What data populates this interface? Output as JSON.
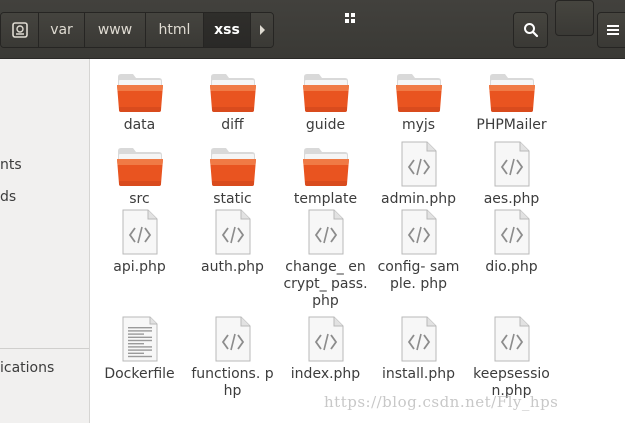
{
  "toolbar": {
    "breadcrumbs": [
      "var",
      "www",
      "html",
      "xss"
    ],
    "active_crumb": "xss"
  },
  "sidebar": {
    "items": [
      "nts",
      "ds",
      "ications"
    ]
  },
  "files": [
    {
      "name": "data",
      "type": "folder"
    },
    {
      "name": "diff",
      "type": "folder"
    },
    {
      "name": "guide",
      "type": "folder"
    },
    {
      "name": "myjs",
      "type": "folder"
    },
    {
      "name": "PHPMailer",
      "type": "folder"
    },
    {
      "name": "src",
      "type": "folder"
    },
    {
      "name": "static",
      "type": "folder"
    },
    {
      "name": "template",
      "type": "folder"
    },
    {
      "name": "admin.php",
      "type": "code"
    },
    {
      "name": "aes.php",
      "type": "code"
    },
    {
      "name": "api.php",
      "type": "code"
    },
    {
      "name": "auth.php",
      "type": "code"
    },
    {
      "name": "change_ encrypt_ pass.php",
      "type": "code"
    },
    {
      "name": "config- sample. php",
      "type": "code"
    },
    {
      "name": "dio.php",
      "type": "code"
    },
    {
      "name": "Dockerfile",
      "type": "text"
    },
    {
      "name": "functions. php",
      "type": "code"
    },
    {
      "name": "index.php",
      "type": "code"
    },
    {
      "name": "install.php",
      "type": "code"
    },
    {
      "name": "keepsessio n.php",
      "type": "code"
    }
  ],
  "watermark": "https://blog.csdn.net/Fly_hps",
  "colors": {
    "header": "#3c3b37",
    "folder_orange": "#e95420",
    "folder_light": "#f4a261",
    "sidebar": "#f1f0ef"
  }
}
